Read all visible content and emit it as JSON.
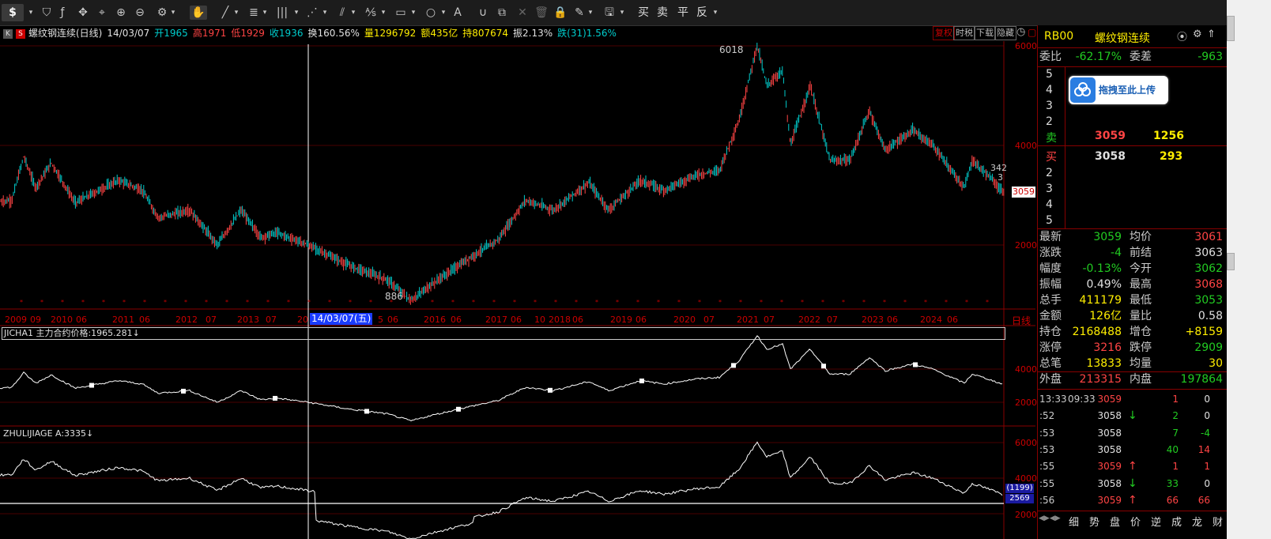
{
  "toolbar": {
    "currency": "$",
    "trade_buttons": [
      "买",
      "卖",
      "平",
      "反"
    ]
  },
  "info": {
    "code_tag": "K",
    "icon": "S",
    "name": "螺纹钢连续(日线)",
    "date": "14/03/07",
    "open": "开1965",
    "high": "高1971",
    "low": "低1929",
    "close": "收1936",
    "turnover": "换160.56%",
    "volume": "量1296792",
    "amount": "额435亿",
    "hold": "持807674",
    "amplitude": "振2.13%",
    "change": "跌(31)1.56%",
    "tags": [
      "复权",
      "时税",
      "下载",
      "隐藏"
    ]
  },
  "chart_labels": {
    "peak_label": "6018",
    "trough_label": "886",
    "crosshair_date": "14/03/07(五)",
    "current_price_tag": "3059",
    "right_edge_label_1": "342",
    "right_edge_label_2": "3",
    "period_tag": "日线",
    "ind1_label": "JICHA1 主力合约价格:1965.281↓",
    "ind2_label": "ZHULIJIAGE A:3335↓",
    "ind2_tag1": "(1199)",
    "ind2_tag2": "2569"
  },
  "price_axis": {
    "main": [
      "6000",
      "4000",
      "2000"
    ],
    "ind1": [
      "4000",
      "2000"
    ],
    "ind2": [
      "6000",
      "4000",
      "2000"
    ]
  },
  "date_axis": [
    "2009",
    "09",
    "2010",
    "06",
    "2011",
    "06",
    "2012",
    "07",
    "2013",
    "07",
    "20",
    "5",
    "06",
    "2016",
    "06",
    "2017",
    "06",
    "10",
    "2018",
    "06",
    "2019",
    "06",
    "2020",
    "07",
    "2021",
    "07",
    "2022",
    "07",
    "2023",
    "06",
    "2024",
    "06"
  ],
  "panel": {
    "code": "RB00",
    "name": "螺纹钢连续",
    "weibi_label": "委比",
    "weibi": "-62.17%",
    "weicha_label": "委差",
    "weicha": "-963",
    "sell_levels": [
      "5",
      "4",
      "3",
      "2"
    ],
    "sell_label": "卖",
    "sell_price": "3059",
    "sell_vol": "1256",
    "buy_label": "买",
    "buy_price": "3058",
    "buy_vol": "293",
    "buy_levels": [
      "2",
      "3",
      "4",
      "5"
    ],
    "upload_text": "拖拽至此上传",
    "stats": [
      {
        "l1": "最新",
        "v1": "3059",
        "c1": "green",
        "l2": "均价",
        "v2": "3061",
        "c2": "red"
      },
      {
        "l1": "涨跌",
        "v1": "-4",
        "c1": "green",
        "l2": "前结",
        "v2": "3063",
        "c2": "white"
      },
      {
        "l1": "幅度",
        "v1": "-0.13%",
        "c1": "green",
        "l2": "今开",
        "v2": "3062",
        "c2": "green"
      },
      {
        "l1": "振幅",
        "v1": "0.49%",
        "c1": "white",
        "l2": "最高",
        "v2": "3068",
        "c2": "red"
      },
      {
        "l1": "总手",
        "v1": "411179",
        "c1": "yellow",
        "l2": "最低",
        "v2": "3053",
        "c2": "green"
      },
      {
        "l1": "金额",
        "v1": "126亿",
        "c1": "yellow",
        "l2": "量比",
        "v2": "0.58",
        "c2": "white"
      },
      {
        "l1": "持仓",
        "v1": "2168488",
        "c1": "yellow",
        "l2": "增仓",
        "v2": "+8159",
        "c2": "yellow"
      },
      {
        "l1": "涨停",
        "v1": "3216",
        "c1": "red",
        "l2": "跌停",
        "v2": "2909",
        "c2": "green"
      },
      {
        "l1": "总笔",
        "v1": "13833",
        "c1": "yellow",
        "l2": "均量",
        "v2": "30",
        "c2": "yellow"
      }
    ],
    "outer_label": "外盘",
    "outer": "213315",
    "inner_label": "内盘",
    "inner": "197864",
    "ticks": [
      {
        "t": "13:33",
        "t2": "09:33",
        "p": "3059",
        "pc": "red",
        "arrow": "",
        "ac": "",
        "v": "1",
        "vc": "red",
        "o": "0",
        "oc": "white"
      },
      {
        "t": ":52",
        "t2": "",
        "p": "3058",
        "pc": "white",
        "arrow": "↓",
        "ac": "green",
        "v": "2",
        "vc": "green",
        "o": "0",
        "oc": "white"
      },
      {
        "t": ":53",
        "t2": "",
        "p": "3058",
        "pc": "white",
        "arrow": "",
        "ac": "",
        "v": "7",
        "vc": "green",
        "o": "-4",
        "oc": "green"
      },
      {
        "t": ":53",
        "t2": "",
        "p": "3058",
        "pc": "white",
        "arrow": "",
        "ac": "",
        "v": "40",
        "vc": "green",
        "o": "14",
        "oc": "red"
      },
      {
        "t": ":55",
        "t2": "",
        "p": "3059",
        "pc": "red",
        "arrow": "↑",
        "ac": "red",
        "v": "1",
        "vc": "red",
        "o": "1",
        "oc": "red"
      },
      {
        "t": ":55",
        "t2": "",
        "p": "3058",
        "pc": "white",
        "arrow": "↓",
        "ac": "green",
        "v": "33",
        "vc": "green",
        "o": "0",
        "oc": "white"
      },
      {
        "t": ":56",
        "t2": "",
        "p": "3059",
        "pc": "red",
        "arrow": "↑",
        "ac": "red",
        "v": "66",
        "vc": "red",
        "o": "66",
        "oc": "red"
      }
    ],
    "bottom_tabs": [
      "细",
      "势",
      "盘",
      "价",
      "逆",
      "成",
      "龙",
      "财"
    ]
  },
  "colors": {
    "up": "#ff4444",
    "down": "#00cccc",
    "axis": "#cc0000",
    "grid": "#550000"
  }
}
